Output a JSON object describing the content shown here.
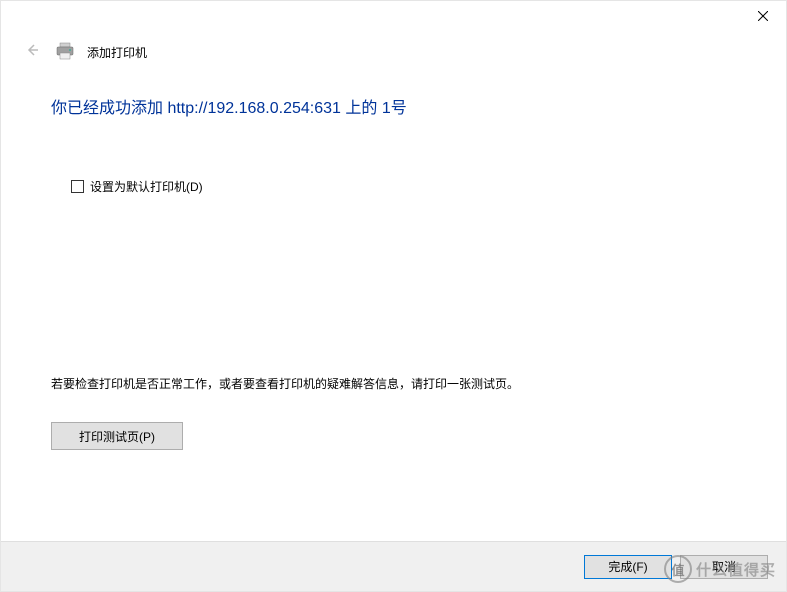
{
  "titlebar": {
    "close_label": "关闭"
  },
  "header": {
    "title": "添加打印机"
  },
  "content": {
    "heading": "你已经成功添加 http://192.168.0.254:631 上的 1号",
    "checkbox_label": "设置为默认打印机(D)",
    "checkbox_checked": false,
    "instruction": "若要检查打印机是否正常工作，或者要查看打印机的疑难解答信息，请打印一张测试页。",
    "test_page_button": "打印测试页(P)"
  },
  "footer": {
    "finish_button": "完成(F)",
    "cancel_button": "取消"
  },
  "watermark": {
    "char": "值",
    "text": "什么值得买"
  }
}
